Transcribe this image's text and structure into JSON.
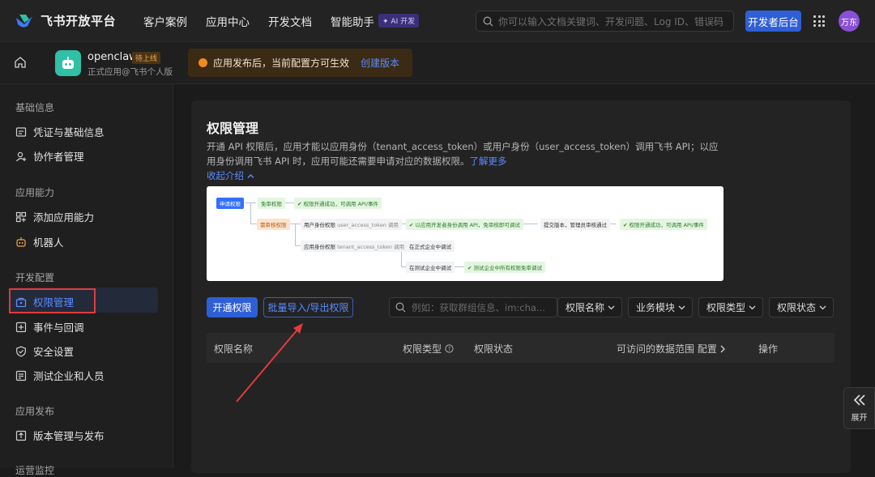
{
  "topbar": {
    "logo_text": "飞书开放平台",
    "nav": [
      "客户案例",
      "应用中心",
      "开发文档",
      "智能助手"
    ],
    "ai_badge": "✦ AI 开发",
    "search_placeholder": "你可以输入文档关键词、开发问题、Log ID、错误码",
    "dev_button": "开发者后台",
    "avatar": "万东"
  },
  "app": {
    "name": "openclaw",
    "badge": "待上线",
    "sub": "正式应用@飞书个人版",
    "notice": "应用发布后，当前配置方可生效",
    "notice_link": "创建版本"
  },
  "sidebar": {
    "sections": [
      {
        "title": "基础信息",
        "items": [
          "凭证与基础信息",
          "协作者管理"
        ]
      },
      {
        "title": "应用能力",
        "items": [
          "添加应用能力",
          "机器人"
        ]
      },
      {
        "title": "开发配置",
        "items": [
          "权限管理",
          "事件与回调",
          "安全设置",
          "测试企业和人员"
        ]
      },
      {
        "title": "应用发布",
        "items": [
          "版本管理与发布"
        ]
      },
      {
        "title": "运营监控",
        "items": []
      }
    ],
    "active": "权限管理"
  },
  "main": {
    "title": "权限管理",
    "desc": "开通 API 权限后，应用才能以应用身份（tenant_access_token）或用户身份（user_access_token）调用飞书 API；以应用身份调用飞书 API 时，应用可能还需要申请对应的数据权限。",
    "desc_link": "了解更多",
    "collapse": "收起介绍",
    "diagram": {
      "apply": "申请权限",
      "free": "免审权限",
      "free_result": "权限开通成功，可调用 API/事件",
      "review": "需审核权限",
      "user_token": "用户身份权限",
      "user_token_sub": "user_access_token 调用",
      "dev_call": "以应用开发者身份调用 API，免审核即可调试",
      "submit": "提交版本，管理员审核通过",
      "success": "权限开通成功，可调用 API/事件",
      "app_token": "应用身份权限",
      "app_token_sub": "tenant_access_token 调用",
      "formal": "在正式企业中调试",
      "test": "在测试企业中调试",
      "test_result": "测试企业中所有权限免审调试"
    },
    "btn_open": "开通权限",
    "btn_batch": "批量导入/导出权限",
    "filter_placeholder": "例如：获取群组信息、im:cha...",
    "selects": [
      "权限名称",
      "业务模块",
      "权限类型",
      "权限状态"
    ],
    "table_headers": [
      "权限名称",
      "权限类型",
      "权限状态",
      "可访问的数据范围 配置",
      "操作"
    ]
  },
  "expand_label": "展开"
}
